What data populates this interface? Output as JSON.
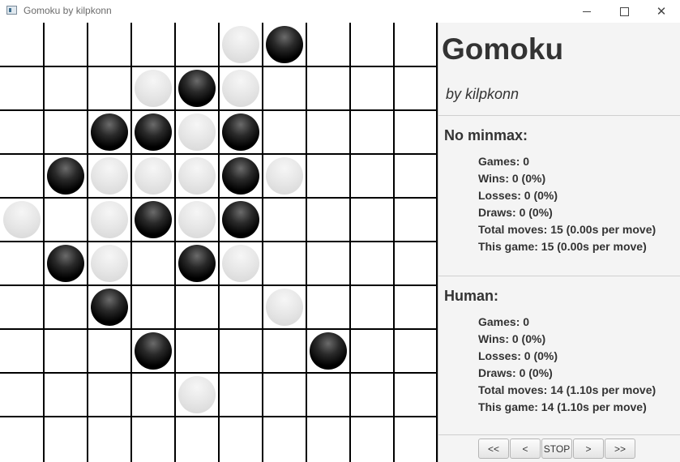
{
  "window": {
    "title": "Gomoku by kilpkonn",
    "close_glyph": "✕"
  },
  "board": {
    "size": 10,
    "stones": [
      {
        "row": 0,
        "col": 5,
        "color": "white"
      },
      {
        "row": 0,
        "col": 6,
        "color": "black"
      },
      {
        "row": 1,
        "col": 3,
        "color": "white"
      },
      {
        "row": 1,
        "col": 4,
        "color": "black"
      },
      {
        "row": 1,
        "col": 5,
        "color": "white"
      },
      {
        "row": 2,
        "col": 2,
        "color": "black"
      },
      {
        "row": 2,
        "col": 3,
        "color": "black"
      },
      {
        "row": 2,
        "col": 4,
        "color": "white"
      },
      {
        "row": 2,
        "col": 5,
        "color": "black"
      },
      {
        "row": 3,
        "col": 1,
        "color": "black"
      },
      {
        "row": 3,
        "col": 2,
        "color": "white"
      },
      {
        "row": 3,
        "col": 3,
        "color": "white"
      },
      {
        "row": 3,
        "col": 4,
        "color": "white"
      },
      {
        "row": 3,
        "col": 5,
        "color": "black"
      },
      {
        "row": 3,
        "col": 6,
        "color": "white"
      },
      {
        "row": 4,
        "col": 0,
        "color": "white"
      },
      {
        "row": 4,
        "col": 2,
        "color": "white"
      },
      {
        "row": 4,
        "col": 3,
        "color": "black"
      },
      {
        "row": 4,
        "col": 4,
        "color": "white"
      },
      {
        "row": 4,
        "col": 5,
        "color": "black"
      },
      {
        "row": 5,
        "col": 1,
        "color": "black"
      },
      {
        "row": 5,
        "col": 2,
        "color": "white"
      },
      {
        "row": 5,
        "col": 4,
        "color": "black"
      },
      {
        "row": 5,
        "col": 5,
        "color": "white"
      },
      {
        "row": 6,
        "col": 2,
        "color": "black"
      },
      {
        "row": 6,
        "col": 6,
        "color": "white"
      },
      {
        "row": 7,
        "col": 3,
        "color": "black"
      },
      {
        "row": 7,
        "col": 7,
        "color": "black"
      },
      {
        "row": 8,
        "col": 4,
        "color": "white"
      }
    ]
  },
  "panel": {
    "title": "Gomoku",
    "subtitle": "by kilpkonn",
    "players": [
      {
        "heading": "No minmax:",
        "stats": [
          "Games: 0",
          "Wins: 0 (0%)",
          "Losses: 0 (0%)",
          "Draws: 0 (0%)",
          "Total moves: 15 (0.00s per move)",
          "This game: 15 (0.00s per move)"
        ]
      },
      {
        "heading": "Human:",
        "stats": [
          "Games: 0",
          "Wins: 0 (0%)",
          "Losses: 0 (0%)",
          "Draws: 0 (0%)",
          "Total moves: 14 (1.10s per move)",
          "This game: 14 (1.10s per move)"
        ]
      }
    ]
  },
  "controls": [
    {
      "label": "<<",
      "name": "first-move-button"
    },
    {
      "label": "<",
      "name": "previous-move-button"
    },
    {
      "label": "STOP",
      "name": "stop-button"
    },
    {
      "label": ">",
      "name": "next-move-button"
    },
    {
      "label": ">>",
      "name": "last-move-button"
    }
  ],
  "colors": {
    "black_stone": "#000000",
    "white_stone": "#e6e6e6",
    "grid": "#000000",
    "panel_bg": "#f4f4f4"
  }
}
